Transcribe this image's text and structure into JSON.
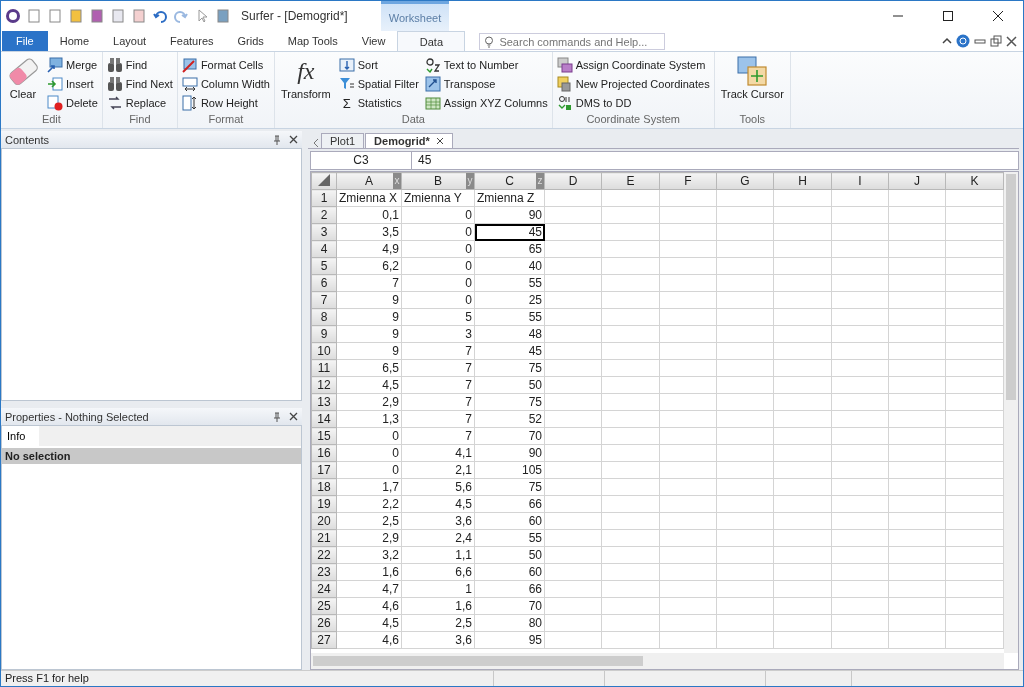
{
  "window": {
    "title": "Surfer - [Demogrid*]",
    "context_tab": "Worksheet"
  },
  "ribbon_tabs": [
    {
      "label": "File",
      "kind": "file",
      "selected": false
    },
    {
      "label": "Home",
      "kind": "tab",
      "selected": false
    },
    {
      "label": "Layout",
      "kind": "tab",
      "selected": false
    },
    {
      "label": "Features",
      "kind": "tab",
      "selected": false
    },
    {
      "label": "Grids",
      "kind": "tab",
      "selected": false
    },
    {
      "label": "Map Tools",
      "kind": "tab",
      "selected": false
    },
    {
      "label": "View",
      "kind": "tab",
      "selected": false
    },
    {
      "label": "Data",
      "kind": "tab",
      "selected": true
    }
  ],
  "search": {
    "placeholder": "Search commands and Help..."
  },
  "ribbon_groups": [
    {
      "label": "Edit",
      "items": [
        {
          "kind": "large",
          "label": "Clear"
        },
        {
          "kind": "stack",
          "buttons": [
            {
              "label": "Merge"
            },
            {
              "label": "Insert"
            },
            {
              "label": "Delete"
            }
          ]
        }
      ]
    },
    {
      "label": "Find",
      "items": [
        {
          "kind": "stack",
          "buttons": [
            {
              "label": "Find"
            },
            {
              "label": "Find Next"
            },
            {
              "label": "Replace"
            }
          ]
        }
      ]
    },
    {
      "label": "Format",
      "items": [
        {
          "kind": "stack",
          "buttons": [
            {
              "label": "Format Cells"
            },
            {
              "label": "Column Width"
            },
            {
              "label": "Row Height"
            }
          ]
        }
      ]
    },
    {
      "label": "Data",
      "items": [
        {
          "kind": "large",
          "label": "Transform",
          "glyph": "fx"
        },
        {
          "kind": "stack",
          "buttons": [
            {
              "label": "Sort"
            },
            {
              "label": "Spatial Filter"
            },
            {
              "label": "Statistics",
              "glyph": "Σ"
            }
          ]
        },
        {
          "kind": "stack",
          "buttons": [
            {
              "label": "Text to Number"
            },
            {
              "label": "Transpose"
            },
            {
              "label": "Assign XYZ Columns"
            }
          ]
        }
      ]
    },
    {
      "label": "Coordinate System",
      "items": [
        {
          "kind": "stack",
          "buttons": [
            {
              "label": "Assign Coordinate System"
            },
            {
              "label": "New Projected Coordinates"
            },
            {
              "label": "DMS to DD"
            }
          ]
        }
      ]
    },
    {
      "label": "Tools",
      "items": [
        {
          "kind": "large",
          "label": "Track Cursor"
        }
      ]
    }
  ],
  "contents_panel": {
    "title": "Contents"
  },
  "properties_panel": {
    "title": "Properties - Nothing Selected",
    "tabs": [
      {
        "label": "Info",
        "selected": true
      }
    ],
    "header": "No selection"
  },
  "document_tabs": [
    {
      "label": "Plot1",
      "selected": false
    },
    {
      "label": "Demogrid*",
      "selected": true
    }
  ],
  "formula_bar": {
    "cell": "C3",
    "value": "45"
  },
  "columns": [
    {
      "label": "A",
      "axis": "x"
    },
    {
      "label": "B",
      "axis": "y"
    },
    {
      "label": "C",
      "axis": "z"
    },
    {
      "label": "D"
    },
    {
      "label": "E"
    },
    {
      "label": "F"
    },
    {
      "label": "G"
    },
    {
      "label": "H"
    },
    {
      "label": "I"
    },
    {
      "label": "J"
    },
    {
      "label": "K"
    }
  ],
  "rows": [
    {
      "number": "1",
      "kind": "header",
      "cells": [
        {
          "value": "Zmienna X",
          "selected": false
        },
        {
          "value": "Zmienna Y",
          "selected": false
        },
        {
          "value": "Zmienna Z",
          "selected": false
        }
      ]
    },
    {
      "number": "2",
      "kind": "data",
      "cells": [
        {
          "value": "0,1",
          "selected": false
        },
        {
          "value": "0",
          "selected": false
        },
        {
          "value": "90",
          "selected": false
        }
      ]
    },
    {
      "number": "3",
      "kind": "data",
      "cells": [
        {
          "value": "3,5",
          "selected": false
        },
        {
          "value": "0",
          "selected": false
        },
        {
          "value": "45",
          "selected": true
        }
      ]
    },
    {
      "number": "4",
      "kind": "data",
      "cells": [
        {
          "value": "4,9",
          "selected": false
        },
        {
          "value": "0",
          "selected": false
        },
        {
          "value": "65",
          "selected": false
        }
      ]
    },
    {
      "number": "5",
      "kind": "data",
      "cells": [
        {
          "value": "6,2",
          "selected": false
        },
        {
          "value": "0",
          "selected": false
        },
        {
          "value": "40",
          "selected": false
        }
      ]
    },
    {
      "number": "6",
      "kind": "data",
      "cells": [
        {
          "value": "7",
          "selected": false
        },
        {
          "value": "0",
          "selected": false
        },
        {
          "value": "55",
          "selected": false
        }
      ]
    },
    {
      "number": "7",
      "kind": "data",
      "cells": [
        {
          "value": "9",
          "selected": false
        },
        {
          "value": "0",
          "selected": false
        },
        {
          "value": "25",
          "selected": false
        }
      ]
    },
    {
      "number": "8",
      "kind": "data",
      "cells": [
        {
          "value": "9",
          "selected": false
        },
        {
          "value": "5",
          "selected": false
        },
        {
          "value": "55",
          "selected": false
        }
      ]
    },
    {
      "number": "9",
      "kind": "data",
      "cells": [
        {
          "value": "9",
          "selected": false
        },
        {
          "value": "3",
          "selected": false
        },
        {
          "value": "48",
          "selected": false
        }
      ]
    },
    {
      "number": "10",
      "kind": "data",
      "cells": [
        {
          "value": "9",
          "selected": false
        },
        {
          "value": "7",
          "selected": false
        },
        {
          "value": "45",
          "selected": false
        }
      ]
    },
    {
      "number": "11",
      "kind": "data",
      "cells": [
        {
          "value": "6,5",
          "selected": false
        },
        {
          "value": "7",
          "selected": false
        },
        {
          "value": "75",
          "selected": false
        }
      ]
    },
    {
      "number": "12",
      "kind": "data",
      "cells": [
        {
          "value": "4,5",
          "selected": false
        },
        {
          "value": "7",
          "selected": false
        },
        {
          "value": "50",
          "selected": false
        }
      ]
    },
    {
      "number": "13",
      "kind": "data",
      "cells": [
        {
          "value": "2,9",
          "selected": false
        },
        {
          "value": "7",
          "selected": false
        },
        {
          "value": "75",
          "selected": false
        }
      ]
    },
    {
      "number": "14",
      "kind": "data",
      "cells": [
        {
          "value": "1,3",
          "selected": false
        },
        {
          "value": "7",
          "selected": false
        },
        {
          "value": "52",
          "selected": false
        }
      ]
    },
    {
      "number": "15",
      "kind": "data",
      "cells": [
        {
          "value": "0",
          "selected": false
        },
        {
          "value": "7",
          "selected": false
        },
        {
          "value": "70",
          "selected": false
        }
      ]
    },
    {
      "number": "16",
      "kind": "data",
      "cells": [
        {
          "value": "0",
          "selected": false
        },
        {
          "value": "4,1",
          "selected": false
        },
        {
          "value": "90",
          "selected": false
        }
      ]
    },
    {
      "number": "17",
      "kind": "data",
      "cells": [
        {
          "value": "0",
          "selected": false
        },
        {
          "value": "2,1",
          "selected": false
        },
        {
          "value": "105",
          "selected": false
        }
      ]
    },
    {
      "number": "18",
      "kind": "data",
      "cells": [
        {
          "value": "1,7",
          "selected": false
        },
        {
          "value": "5,6",
          "selected": false
        },
        {
          "value": "75",
          "selected": false
        }
      ]
    },
    {
      "number": "19",
      "kind": "data",
      "cells": [
        {
          "value": "2,2",
          "selected": false
        },
        {
          "value": "4,5",
          "selected": false
        },
        {
          "value": "66",
          "selected": false
        }
      ]
    },
    {
      "number": "20",
      "kind": "data",
      "cells": [
        {
          "value": "2,5",
          "selected": false
        },
        {
          "value": "3,6",
          "selected": false
        },
        {
          "value": "60",
          "selected": false
        }
      ]
    },
    {
      "number": "21",
      "kind": "data",
      "cells": [
        {
          "value": "2,9",
          "selected": false
        },
        {
          "value": "2,4",
          "selected": false
        },
        {
          "value": "55",
          "selected": false
        }
      ]
    },
    {
      "number": "22",
      "kind": "data",
      "cells": [
        {
          "value": "3,2",
          "selected": false
        },
        {
          "value": "1,1",
          "selected": false
        },
        {
          "value": "50",
          "selected": false
        }
      ]
    },
    {
      "number": "23",
      "kind": "data",
      "cells": [
        {
          "value": "1,6",
          "selected": false
        },
        {
          "value": "6,6",
          "selected": false
        },
        {
          "value": "60",
          "selected": false
        }
      ]
    },
    {
      "number": "24",
      "kind": "data",
      "cells": [
        {
          "value": "4,7",
          "selected": false
        },
        {
          "value": "1",
          "selected": false
        },
        {
          "value": "66",
          "selected": false
        }
      ]
    },
    {
      "number": "25",
      "kind": "data",
      "cells": [
        {
          "value": "4,6",
          "selected": false
        },
        {
          "value": "1,6",
          "selected": false
        },
        {
          "value": "70",
          "selected": false
        }
      ]
    },
    {
      "number": "26",
      "kind": "data",
      "cells": [
        {
          "value": "4,5",
          "selected": false
        },
        {
          "value": "2,5",
          "selected": false
        },
        {
          "value": "80",
          "selected": false
        }
      ]
    },
    {
      "number": "27",
      "kind": "data",
      "cells": [
        {
          "value": "4,6",
          "selected": false
        },
        {
          "value": "3,6",
          "selected": false
        },
        {
          "value": "95",
          "selected": false
        }
      ]
    }
  ],
  "status_bar": {
    "message": "Press F1 for help"
  }
}
